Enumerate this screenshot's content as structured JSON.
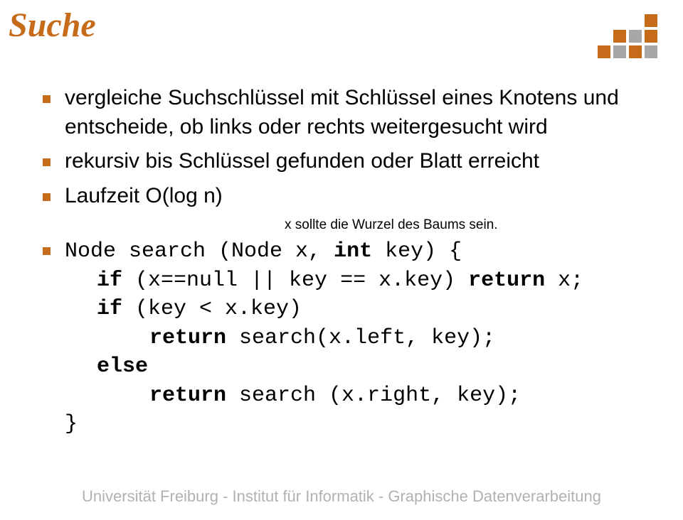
{
  "title": "Suche",
  "bullets": {
    "b1": "vergleiche Suchschlüssel mit Schlüssel eines Knotens und entscheide, ob links oder rechts weitergesucht wird",
    "b2": "rekursiv bis Schlüssel gefunden oder Blatt erreicht",
    "b3": "Laufzeit O(log n)"
  },
  "annotation": "x sollte die Wurzel des Baums sein.",
  "code": {
    "l1a": "Node search (Node x, ",
    "l1_kw": "int",
    "l1b": " key) {",
    "l2_kw": "if",
    "l2a": " (x==null || key == x.key) ",
    "l2_kw2": "return",
    "l2b": " x;",
    "l3_kw": "if",
    "l3a": " (key < x.key)",
    "l4_kw": "return",
    "l4a": " search(x.left, key);",
    "l5_kw": "else",
    "l6_kw": "return",
    "l6a": " search (x.right, key);",
    "l7": "}"
  },
  "footer": "Universität Freiburg - Institut für Informatik - Graphische Datenverarbeitung"
}
